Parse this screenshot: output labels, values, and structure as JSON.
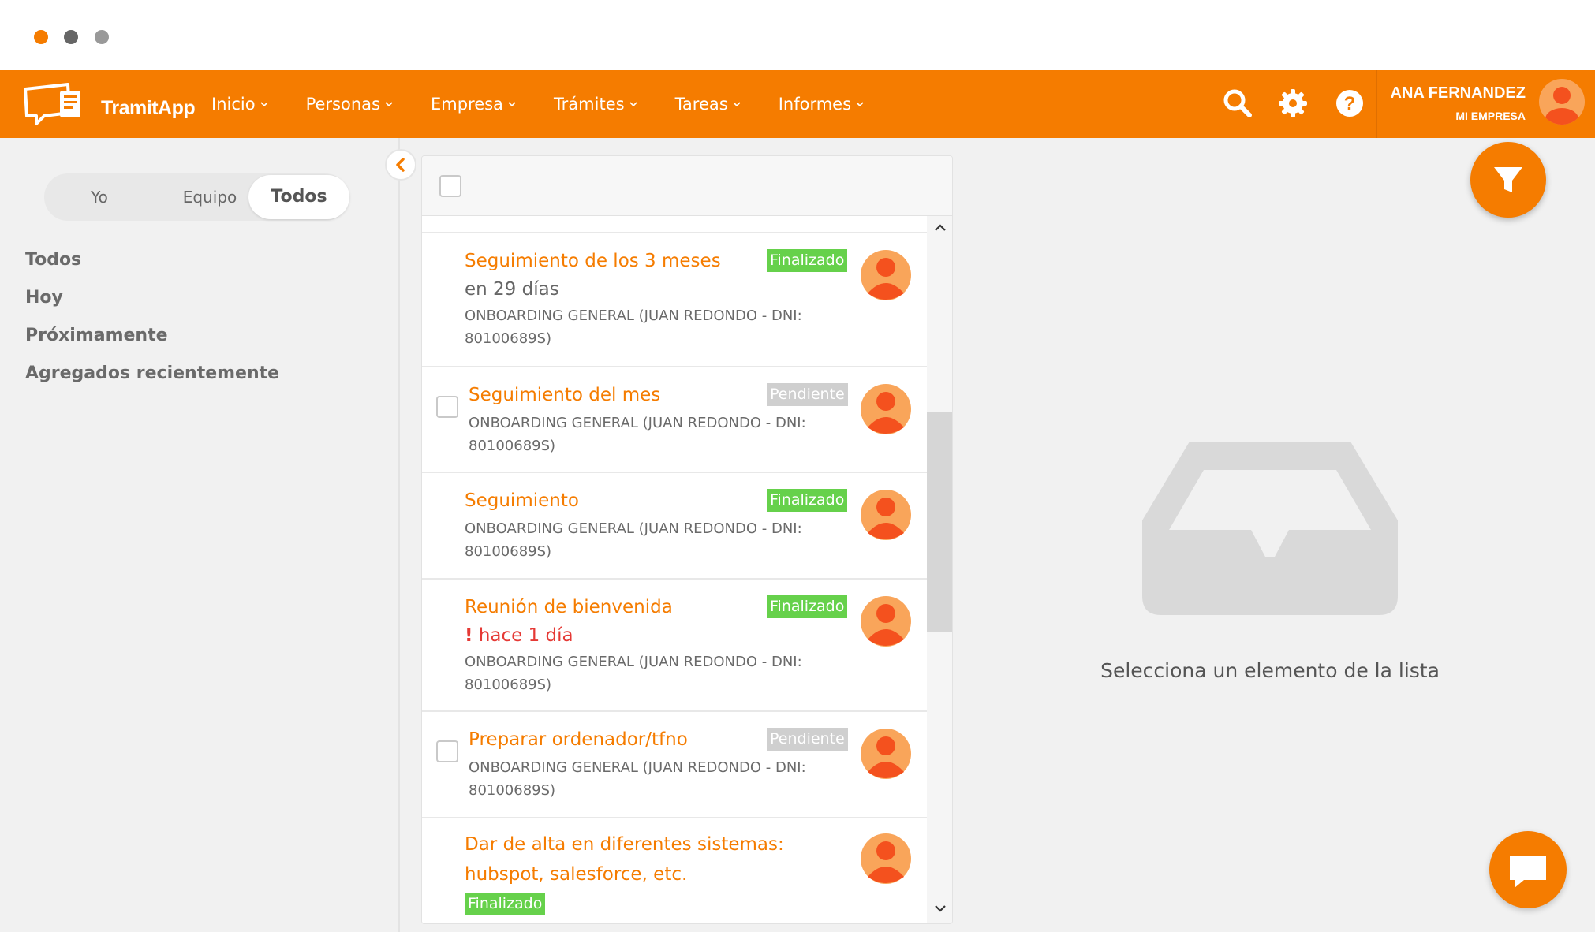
{
  "app": {
    "logo_text": "TramitApp"
  },
  "nav": {
    "items": [
      {
        "label": "Inicio"
      },
      {
        "label": "Personas"
      },
      {
        "label": "Empresa"
      },
      {
        "label": "Trámites"
      },
      {
        "label": "Tareas"
      },
      {
        "label": "Informes"
      }
    ]
  },
  "header_icons": [
    "search-icon",
    "gear-icon",
    "help-icon"
  ],
  "user": {
    "name": "ANA FERNANDEZ",
    "company": "MI EMPRESA"
  },
  "scope_toggle": {
    "options": [
      "Yo",
      "Equipo",
      "Todos"
    ],
    "selected": "Todos"
  },
  "side_menu": {
    "items": [
      "Todos",
      "Hoy",
      "Próximamente",
      "Agregados recientemente"
    ]
  },
  "tasks": [
    {
      "title": "Seguimiento de los 3 meses",
      "due": "en 29 días",
      "overdue": false,
      "process": "ONBOARDING GENERAL (JUAN REDONDO - DNI:",
      "process_id": "80100689S)",
      "status": "Finalizado",
      "checkbox": false
    },
    {
      "title": "Seguimiento del mes",
      "due": "",
      "overdue": false,
      "process": "ONBOARDING GENERAL (JUAN REDONDO - DNI:",
      "process_id": "80100689S)",
      "status": "Pendiente",
      "checkbox": true
    },
    {
      "title": "Seguimiento",
      "due": "",
      "overdue": false,
      "process": "ONBOARDING GENERAL (JUAN REDONDO - DNI:",
      "process_id": "80100689S)",
      "status": "Finalizado",
      "checkbox": false
    },
    {
      "title": "Reunión de bienvenida",
      "due_mark": "!",
      "due": "hace 1 día",
      "overdue": true,
      "process": "ONBOARDING GENERAL (JUAN REDONDO - DNI:",
      "process_id": "80100689S)",
      "status": "Finalizado",
      "checkbox": false
    },
    {
      "title": "Preparar ordenador/tfno",
      "due": "",
      "overdue": false,
      "process": "ONBOARDING GENERAL (JUAN REDONDO - DNI:",
      "process_id": "80100689S)",
      "status": "Pendiente",
      "checkbox": true
    },
    {
      "title_line1": "Dar de alta en diferentes sistemas:",
      "title_line2": "hubspot, salesforce, etc.",
      "status": "Finalizado",
      "checkbox": false
    }
  ],
  "empty_state": {
    "message": "Selecciona un elemento de la lista"
  },
  "colors": {
    "brand": "#f57c00",
    "done": "#66d14b",
    "pending": "#cfcfcf",
    "overdue": "#e53935"
  }
}
